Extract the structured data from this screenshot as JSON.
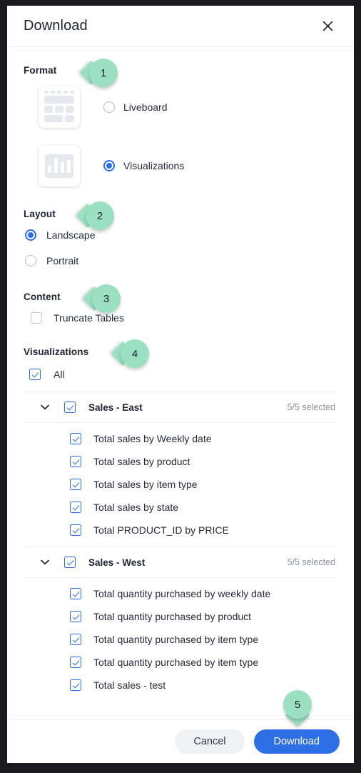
{
  "dialog": {
    "title": "Download",
    "close_icon": "close-icon"
  },
  "format": {
    "label": "Format",
    "badge": "1",
    "options": [
      {
        "label": "Liveboard",
        "icon": "liveboard-grid-icon",
        "selected": false
      },
      {
        "label": "Visualizations",
        "icon": "bar-chart-icon",
        "selected": true
      }
    ]
  },
  "layout": {
    "label": "Layout",
    "badge": "2",
    "options": [
      {
        "label": "Landscape",
        "selected": true
      },
      {
        "label": "Portrait",
        "selected": false
      }
    ]
  },
  "content": {
    "label": "Content",
    "badge": "3",
    "options": [
      {
        "label": "Truncate Tables",
        "checked": false
      }
    ]
  },
  "visualizations": {
    "label": "Visualizations",
    "badge": "4",
    "all_label": "All",
    "all_checked": true,
    "groups": [
      {
        "name": "Sales - East",
        "count": "5/5 selected",
        "checked": true,
        "expanded": true,
        "items": [
          {
            "label": "Total sales by Weekly date",
            "checked": true
          },
          {
            "label": "Total sales by product",
            "checked": true
          },
          {
            "label": "Total sales by item type",
            "checked": true
          },
          {
            "label": "Total sales by state",
            "checked": true
          },
          {
            "label": "Total PRODUCT_ID by PRICE",
            "checked": true
          }
        ]
      },
      {
        "name": "Sales - West",
        "count": "5/5 selected",
        "checked": true,
        "expanded": true,
        "items": [
          {
            "label": "Total quantity purchased by weekly date",
            "checked": true
          },
          {
            "label": "Total quantity purchased by product",
            "checked": true
          },
          {
            "label": "Total quantity purchased by item type",
            "checked": true
          },
          {
            "label": "Total quantity purchased by item type",
            "checked": true
          },
          {
            "label": "Total sales - test",
            "checked": true
          }
        ]
      }
    ]
  },
  "footer": {
    "cancel_label": "Cancel",
    "download_label": "Download",
    "download_badge": "5"
  },
  "colors": {
    "accent_blue": "#2f6fe5",
    "badge_green": "#9ce0c2",
    "text_dark": "#1d2330",
    "text_muted": "#8b909b"
  }
}
